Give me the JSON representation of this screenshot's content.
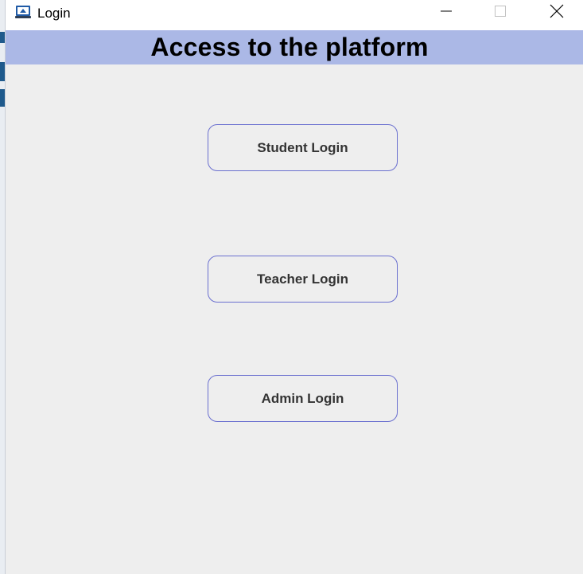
{
  "window": {
    "title": "Login",
    "icon": "app-laptop-icon",
    "controls": {
      "minimize": "minimize-icon",
      "maximize": "maximize-icon",
      "close": "close-icon"
    }
  },
  "header": {
    "title": "Access to the platform",
    "background_color": "#abb8e6"
  },
  "buttons": {
    "student": "Student Login",
    "teacher": "Teacher Login",
    "admin": "Admin Login",
    "border_color": "#6a6fcf"
  },
  "colors": {
    "window_background": "#eeeeee",
    "titlebar_background": "#ffffff"
  }
}
